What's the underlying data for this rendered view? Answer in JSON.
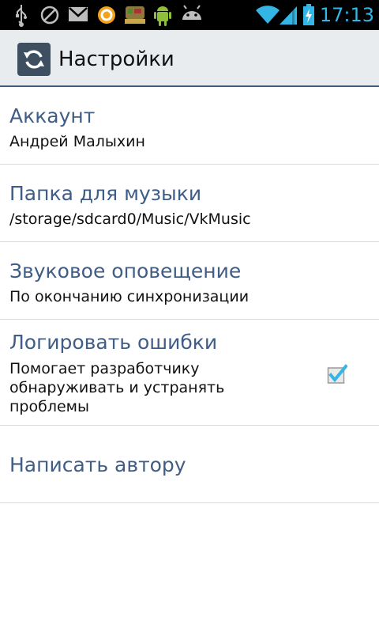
{
  "status_bar": {
    "time": "17:13",
    "icons": [
      "usb-icon",
      "blocked-icon",
      "gmail-icon",
      "app-circle-icon",
      "meat-app-icon",
      "android-icon",
      "android-head-icon",
      "wifi-icon",
      "signal-icon",
      "battery-charging-icon"
    ],
    "accent_color": "#33b5e5"
  },
  "action_bar": {
    "title": "Настройки",
    "icon": "sync-icon"
  },
  "settings": [
    {
      "title": "Аккаунт",
      "summary": "Андрей Малыхин"
    },
    {
      "title": "Папка для музыки",
      "summary": "/storage/sdcard0/Music/VkMusic"
    },
    {
      "title": "Звуковое оповещение",
      "summary": "По окончанию синхронизации"
    },
    {
      "title": "Логировать ошибки",
      "summary_lines": [
        "Помогает разработчику",
        "обнаруживать и устранять",
        "проблемы"
      ],
      "checked": true
    },
    {
      "title": "Написать автору"
    }
  ],
  "colors": {
    "title": "#3f5d85",
    "checkbox": "#33b5e5",
    "divider": "#dadada"
  }
}
